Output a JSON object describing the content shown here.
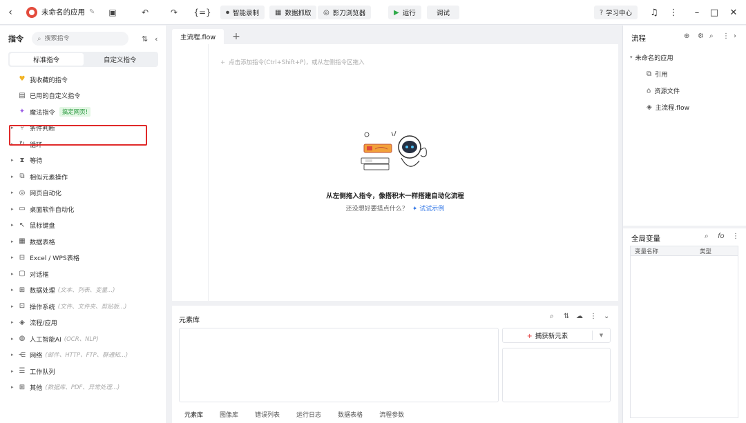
{
  "titlebar": {
    "app_name": "未命名的应用",
    "buttons": {
      "smart_record": "智能录制",
      "data_capture": "数据抓取",
      "browser": "影刀浏览器",
      "run": "运行",
      "debug": "调试",
      "learn": "学习中心"
    }
  },
  "left": {
    "title": "指令",
    "search_placeholder": "搜索指令",
    "tabs": [
      "标准指令",
      "自定义指令"
    ],
    "pinned": [
      {
        "label": "我收藏的指令",
        "icon": "heart-icon"
      },
      {
        "label": "已用的自定义指令",
        "icon": "box-icon"
      },
      {
        "label": "魔法指令",
        "icon": "sparkle-icon",
        "tag": "搞定网页!"
      }
    ],
    "categories": [
      {
        "label": "条件判断",
        "sub": ""
      },
      {
        "label": "循环",
        "sub": ""
      },
      {
        "label": "等待",
        "sub": ""
      },
      {
        "label": "相似元素操作",
        "sub": ""
      },
      {
        "label": "网页自动化",
        "sub": ""
      },
      {
        "label": "桌面软件自动化",
        "sub": ""
      },
      {
        "label": "鼠标键盘",
        "sub": ""
      },
      {
        "label": "数据表格",
        "sub": ""
      },
      {
        "label": "Excel / WPS表格",
        "sub": ""
      },
      {
        "label": "对话框",
        "sub": ""
      },
      {
        "label": "数据处理",
        "sub": "(文本、列表、变量...)"
      },
      {
        "label": "操作系统",
        "sub": "(文件、文件夹、剪贴板...)"
      },
      {
        "label": "流程/应用",
        "sub": ""
      },
      {
        "label": "人工智能AI",
        "sub": "(OCR、NLP)"
      },
      {
        "label": "网络",
        "sub": "(邮件、HTTP、FTP、群通知...)"
      },
      {
        "label": "工作队列",
        "sub": ""
      },
      {
        "label": "其他",
        "sub": "(数据库、PDF、异常处理...)"
      }
    ]
  },
  "center": {
    "tab": "主流程.flow",
    "hint": "点击添加指令(Ctrl+Shift+P)，或从左侧指令区拖入",
    "empty_title": "从左侧拖入指令，像搭积木一样搭建自动化流程",
    "empty_sub": "还没想好要搭点什么？",
    "empty_link": "试试示例"
  },
  "elements": {
    "title": "元素库",
    "capture": "捕获新元素",
    "tabs": [
      "元素库",
      "图像库",
      "错误列表",
      "运行日志",
      "数据表格",
      "流程参数"
    ]
  },
  "right": {
    "flow_title": "流程",
    "tree_root": "未命名的应用",
    "tree_children": [
      {
        "label": "引用",
        "icon": "reference-icon"
      },
      {
        "label": "资源文件",
        "icon": "folder-icon"
      },
      {
        "label": "主流程.flow",
        "icon": "layers-icon"
      }
    ],
    "vars_title": "全局变量",
    "vars_cols": [
      "变量名称",
      "类型"
    ]
  }
}
